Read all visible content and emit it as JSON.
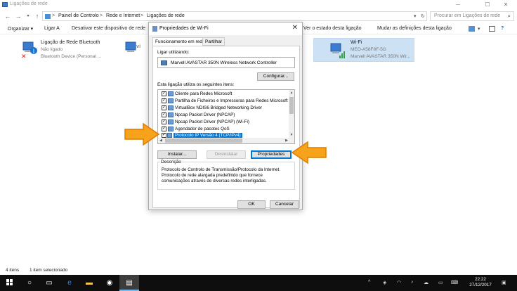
{
  "window": {
    "title": "Ligações de rede",
    "minimize": "─",
    "maximize": "☐",
    "close": "✕"
  },
  "address": {
    "crumbs": [
      "Painel de Controlo",
      "Rede e Internet",
      "Ligações de rede"
    ],
    "separator": ">",
    "search_placeholder": "Procurar em Ligações de rede"
  },
  "toolbar": {
    "organize": "Organizar ▾",
    "connect": "Ligar A",
    "disable": "Desativar este dispositivo de rede",
    "status": "Ver o estado desta ligação",
    "change": "Mudar as definições desta ligação"
  },
  "connections": [
    {
      "name": "Ligação de Rede Bluetooth",
      "status": "Não ligado",
      "device": "Bluetooth Device (Personal ..."
    },
    {
      "name": "Wi-Fi",
      "status": "MEO-A58F8F-5G",
      "device": "Marvell AVASTAR 350N Wir..."
    }
  ],
  "dialog": {
    "title": "Propriedades de Wi-Fi",
    "close": "✕",
    "tabs": [
      "Funcionamento em rede",
      "Partilhar"
    ],
    "connect_using_label": "Ligar utilizando:",
    "adapter": "Marvell AVASTAR 350N Wireless Network Controller",
    "configure": "Configurar...",
    "items_label": "Esta ligação utiliza os seguintes itens:",
    "items": [
      {
        "label": "Cliente para Redes Microsoft",
        "checked": true
      },
      {
        "label": "Partilha de Ficheiros e Impressoras para Redes Microsoft",
        "checked": true
      },
      {
        "label": "VirtualBox NDIS6 Bridged Networking Driver",
        "checked": true
      },
      {
        "label": "Npcap Packet Driver (NPCAP)",
        "checked": true
      },
      {
        "label": "Npcap Packet Driver (NPCAP) (Wi-Fi)",
        "checked": true
      },
      {
        "label": "Agendador de pacotes QoS",
        "checked": true
      },
      {
        "label": "Protocolo IP Versão 4 (TCP/IPv4)",
        "checked": true,
        "selected": true
      }
    ],
    "install": "Instalar...",
    "uninstall": "Desinstalar",
    "properties": "Propriedades",
    "description_label": "Descrição",
    "description": "Protocolo de Controlo de Transmissão/Protocolo da Internet. Protocolo de rede alargada predefinido que fornece comunicações através de diversas redes interligadas.",
    "ok": "OK",
    "cancel": "Cancelar"
  },
  "statusbar": {
    "count": "4 itens",
    "selected": "1 item selecionado"
  },
  "taskbar": {
    "time": "22:22",
    "date": "27/12/2017"
  },
  "colors": {
    "accent": "#0078d7",
    "arrow_fill": "#f7a21b",
    "arrow_stroke": "#e07b00",
    "taskbar": "#0e0e0e",
    "selection": "#cde1f5"
  }
}
